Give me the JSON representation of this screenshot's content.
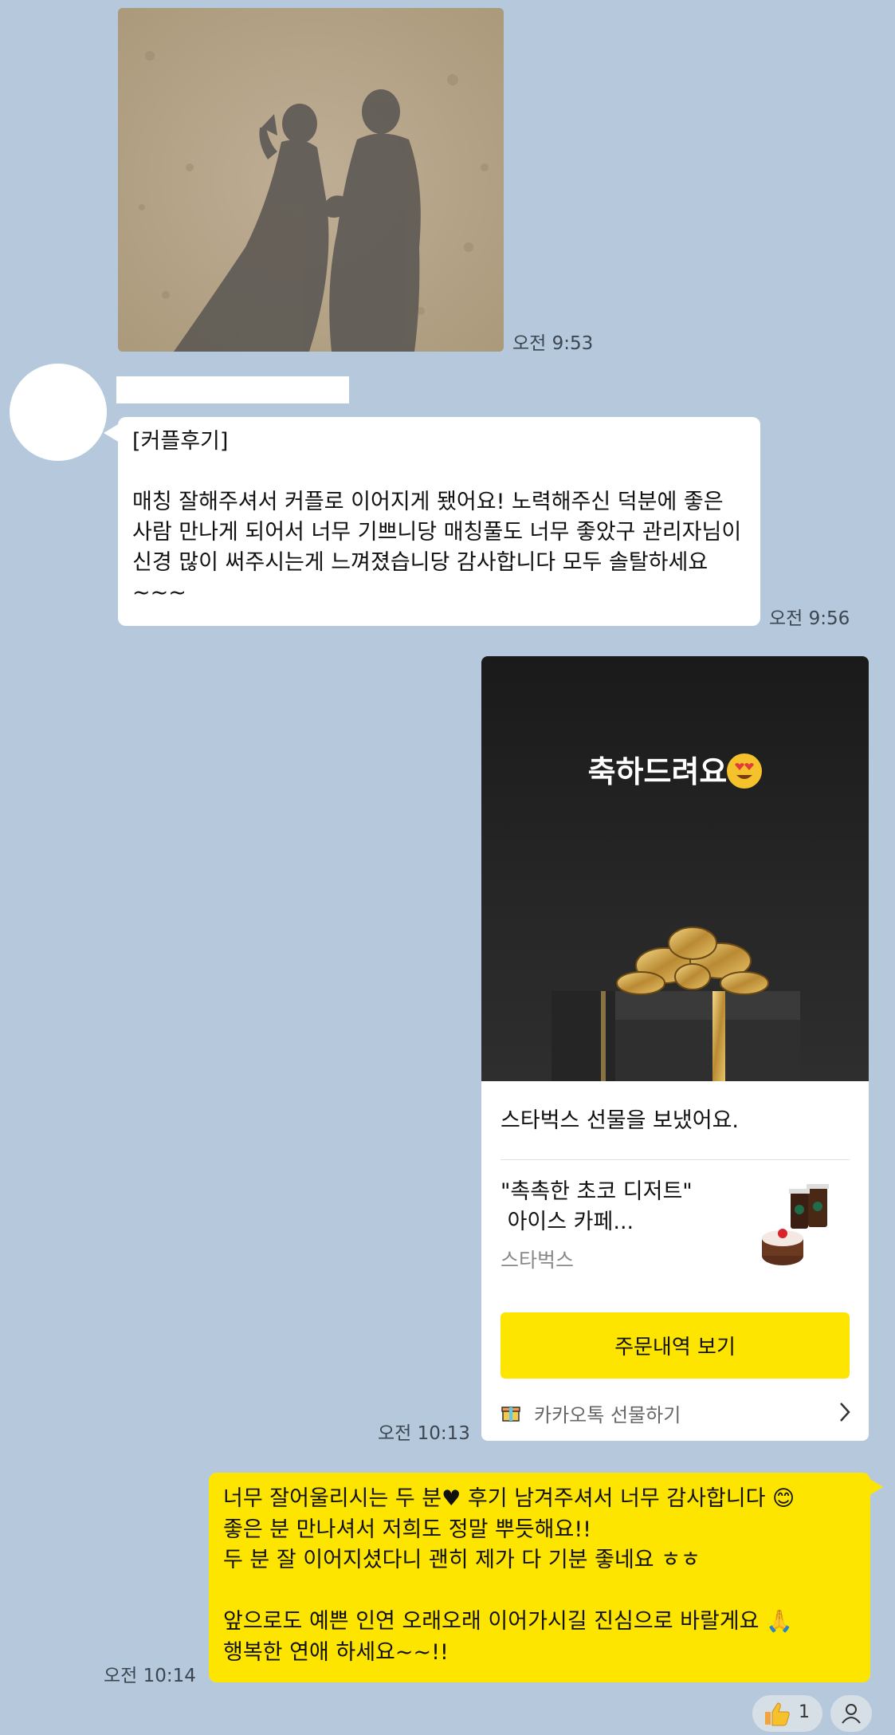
{
  "photo_message": {
    "time": "오전 9:53"
  },
  "review_message": {
    "text": "[커플후기]\n\n매칭 잘해주셔서 커플로 이어지게 됐어요! 노력해주신 덕분에 좋은 사람 만나게 되어서 너무 기쁘니당 매칭풀도 너무 좋았구 관리자님이 신경 많이 써주시는게 느껴졌습니당 감사합니다 모두 솔탈하세요~~~",
    "time": "오전 9:56"
  },
  "gift_message": {
    "hero_title": "축하드려요",
    "sent_text": "스타벅스 선물을 보냈어요.",
    "item_name": "\"촉촉한 초코 디저트\"\n 아이스 카페...",
    "brand": "스타벅스",
    "order_button": "주문내역 보기",
    "footer_label": "카카오톡 선물하기",
    "time": "오전 10:13"
  },
  "reply_message": {
    "text": "너무 잘어울리시는 두 분♥ 후기 남겨주셔서 너무 감사합니다 😊\n좋은 분 만나셔서 저희도 정말 뿌듯해요!!\n두 분 잘 이어지셨다니 괜히 제가 다 기분 좋네요 ㅎㅎ\n\n앞으로도 예쁜 인연 오래오래 이어가시길 진심으로 바랄게요 🙏\n행복한 연애 하세요~~!!",
    "time": "오전 10:14"
  },
  "reactions": {
    "like_count": "1"
  },
  "colors": {
    "background": "#b6c9dc",
    "my_bubble": "#fee500",
    "their_bubble": "#ffffff",
    "order_button": "#fee500"
  }
}
